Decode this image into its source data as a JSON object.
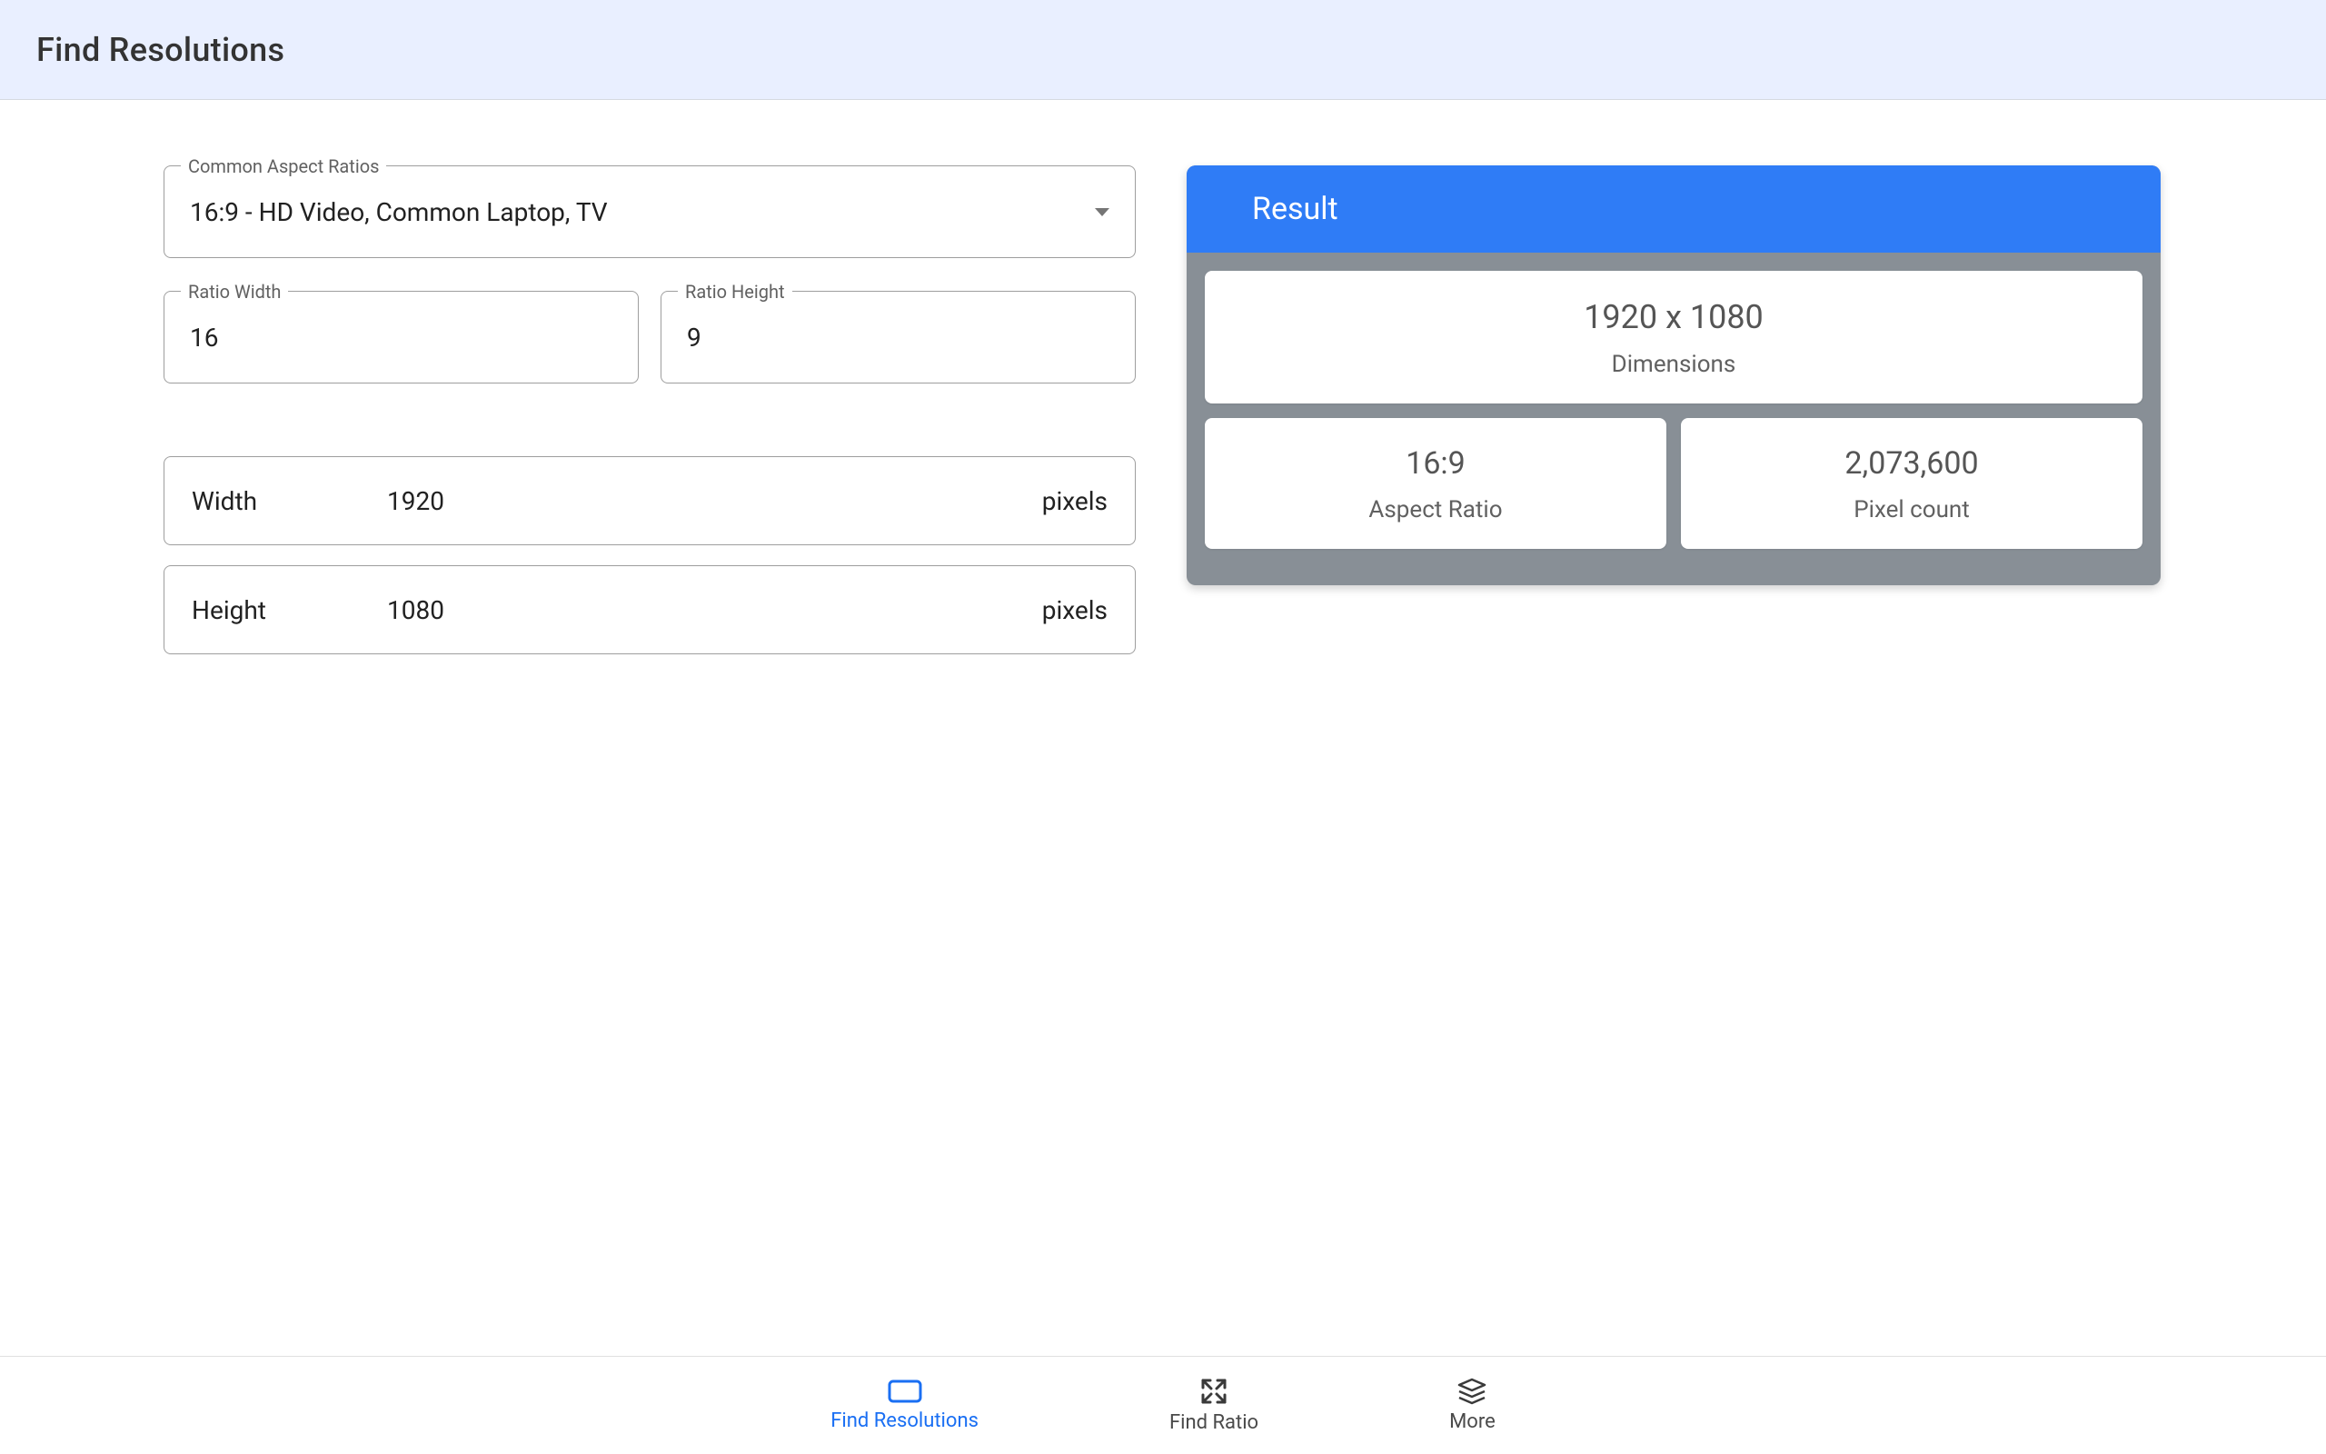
{
  "header": {
    "title": "Find Resolutions"
  },
  "form": {
    "aspect_select_label": "Common Aspect Ratios",
    "aspect_select_value": "16:9 - HD Video, Common Laptop, TV",
    "ratio_width_label": "Ratio Width",
    "ratio_width_value": "16",
    "ratio_height_label": "Ratio Height",
    "ratio_height_value": "9",
    "width_label": "Width",
    "width_value": "1920",
    "height_label": "Height",
    "height_value": "1080",
    "unit": "pixels"
  },
  "result": {
    "title": "Result",
    "dimensions_value": "1920 x 1080",
    "dimensions_caption": "Dimensions",
    "aspect_value": "16:9",
    "aspect_caption": "Aspect Ratio",
    "pixel_count_value": "2,073,600",
    "pixel_count_caption": "Pixel count"
  },
  "nav": {
    "items": [
      {
        "label": "Find Resolutions",
        "icon": "rectangle-icon",
        "active": true
      },
      {
        "label": "Find Ratio",
        "icon": "expand-icon",
        "active": false
      },
      {
        "label": "More",
        "icon": "layers-icon",
        "active": false
      }
    ]
  }
}
